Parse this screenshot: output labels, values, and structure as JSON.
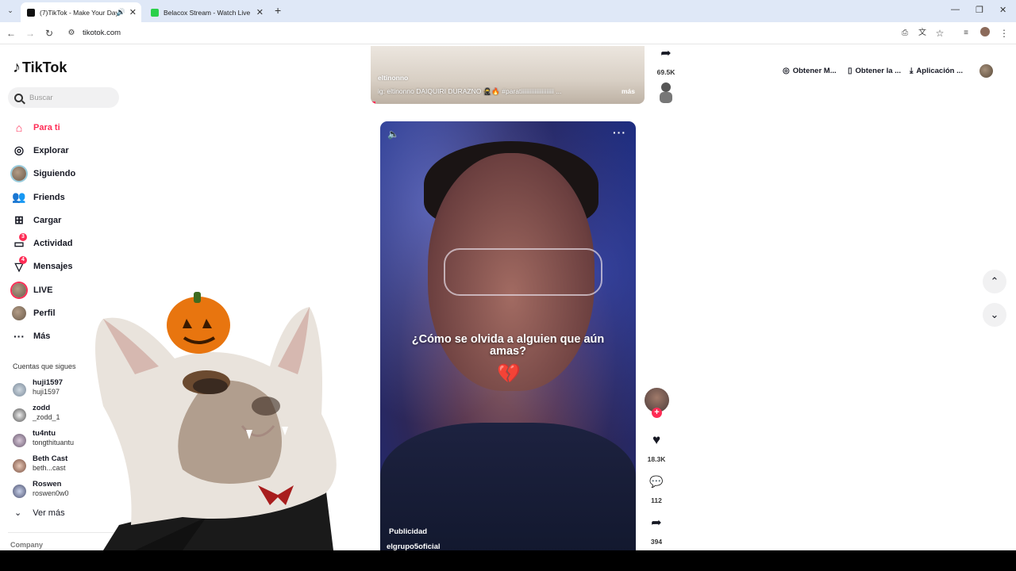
{
  "browser": {
    "tabs": [
      {
        "title": "(7)TikTok - Make Your Day",
        "active": true,
        "audio": true
      },
      {
        "title": "Belacox Stream - Watch Live on",
        "active": false
      }
    ],
    "address": "tikotok.com"
  },
  "sidebar": {
    "logo": "TikTok",
    "search_placeholder": "Buscar",
    "nav": [
      {
        "label": "Para ti",
        "icon": "home-icon",
        "active": true
      },
      {
        "label": "Explorar",
        "icon": "compass-icon"
      },
      {
        "label": "Siguiendo",
        "icon": "following-avatar"
      },
      {
        "label": "Friends",
        "icon": "friends-icon"
      },
      {
        "label": "Cargar",
        "icon": "upload-icon"
      },
      {
        "label": "Actividad",
        "icon": "activity-icon",
        "badge": "3"
      },
      {
        "label": "Mensajes",
        "icon": "messages-icon",
        "badge": "4"
      },
      {
        "label": "LIVE",
        "icon": "live-avatar"
      },
      {
        "label": "Perfil",
        "icon": "profile-avatar"
      },
      {
        "label": "Más",
        "icon": "more-icon"
      }
    ],
    "following_title": "Cuentas que sigues",
    "accounts": [
      {
        "user": "huji1597",
        "name": "huji1597"
      },
      {
        "user": "zodd",
        "name": "_zodd_1"
      },
      {
        "user": "tu4ntu",
        "name": "tongthituantu"
      },
      {
        "user": "Beth Cast",
        "name": "beth...cast"
      },
      {
        "user": "Roswen",
        "name": "roswen0w0"
      }
    ],
    "see_more": "Ver más",
    "company": "Company"
  },
  "header": {
    "links": [
      "Obtener M...",
      "Obtener la ...",
      "Aplicación ..."
    ]
  },
  "feed": {
    "previous": {
      "author": "eltinonno",
      "caption": "ig: eltinonno  DAIQUIRI DURAZNO 🥷🔥  #paratiiiiiiiiiiiiiiiiiiiiii ...",
      "more": "más",
      "shares": "69.5K"
    },
    "current": {
      "overlay_text": "¿Cómo se olvida a alguien que aún amas?",
      "label": "Publicidad",
      "owner": "elgrupo5oficial",
      "likes": "18.3K",
      "comments": "112",
      "shares": "394"
    }
  }
}
